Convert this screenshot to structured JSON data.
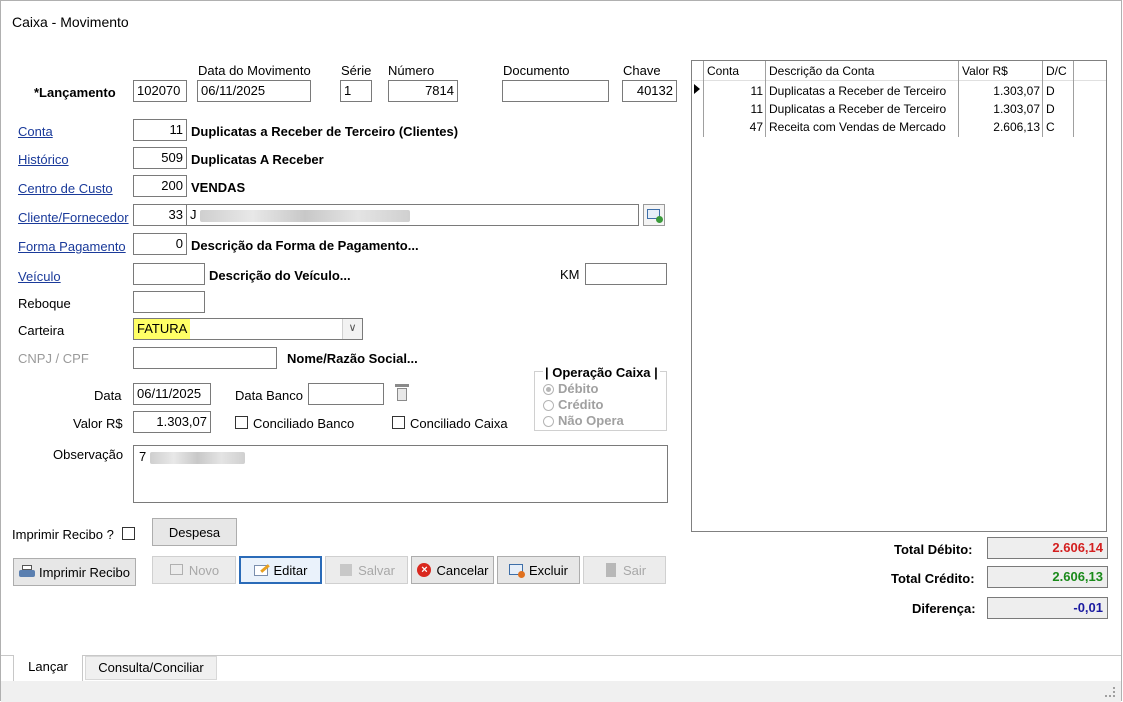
{
  "window": {
    "title": "Caixa - Movimento"
  },
  "header": {
    "lancamento_label": "*Lançamento",
    "lancamento_value": "102070",
    "data_mov_label": "Data do Movimento",
    "data_mov_value": "06/11/2025",
    "serie_label": "Série",
    "serie_value": "1",
    "numero_label": "Número",
    "numero_value": "7814",
    "documento_label": "Documento",
    "documento_value": "",
    "chave_label": "Chave",
    "chave_value": "40132"
  },
  "fields": {
    "conta_label": "Conta",
    "conta_value": "11",
    "conta_desc": "Duplicatas a Receber de Terceiro (Clientes)",
    "historico_label": "Histórico",
    "historico_value": "509",
    "historico_desc": "Duplicatas A Receber",
    "centro_label": "Centro de Custo",
    "centro_value": "200",
    "centro_desc": "VENDAS",
    "cliente_label": "Cliente/Fornecedor",
    "cliente_value": "33",
    "cliente_name_initial": "J",
    "forma_label": "Forma Pagamento",
    "forma_value": "0",
    "forma_desc": "Descrição da Forma de Pagamento...",
    "veiculo_label": "Veículo",
    "veiculo_value": "",
    "veiculo_desc": "Descrição do Veículo...",
    "km_label": "KM",
    "km_value": "",
    "reboque_label": "Reboque",
    "reboque_value": "",
    "carteira_label": "Carteira",
    "carteira_value": "FATURA",
    "cnpj_label": "CNPJ / CPF",
    "cnpj_value": "",
    "nome_label": "Nome/Razão Social...",
    "data_label": "Data",
    "data_value": "06/11/2025",
    "data_banco_label": "Data Banco",
    "data_banco_value": "",
    "valor_label": "Valor R$",
    "valor_value": "1.303,07",
    "conciliado_banco_label": "Conciliado Banco",
    "conciliado_caixa_label": "Conciliado Caixa",
    "observacao_label": "Observação",
    "observacao_initial": "7"
  },
  "operacao": {
    "title": "| Operação Caixa |",
    "options": [
      "Débito",
      "Crédito",
      "Não Opera"
    ],
    "selected": "Débito"
  },
  "recibo": {
    "label": "Imprimir Recibo ?",
    "despesa_label": "Despesa"
  },
  "toolbar": {
    "imprimir_label": "Imprimir Recibo",
    "novo_label": "Novo",
    "editar_label": "Editar",
    "salvar_label": "Salvar",
    "cancelar_label": "Cancelar",
    "excluir_label": "Excluir",
    "sair_label": "Sair"
  },
  "grid": {
    "columns": [
      "Conta",
      "Descrição da Conta",
      "Valor R$",
      "D/C"
    ],
    "rows": [
      {
        "conta": "11",
        "descricao": "Duplicatas a Receber de Terceiro",
        "valor": "1.303,07",
        "dc": "D"
      },
      {
        "conta": "11",
        "descricao": "Duplicatas a Receber de Terceiro",
        "valor": "1.303,07",
        "dc": "D"
      },
      {
        "conta": "47",
        "descricao": "Receita com Vendas de Mercado",
        "valor": "2.606,13",
        "dc": "C"
      }
    ]
  },
  "totals": {
    "debito_label": "Total Débito:",
    "debito_value": "2.606,14",
    "debito_color": "#d42020",
    "credito_label": "Total Crédito:",
    "credito_value": "2.606,13",
    "credito_color": "#1a8a1a",
    "diferenca_label": "Diferença:",
    "diferenca_value": "-0,01",
    "diferenca_color": "#1a1aa0"
  },
  "tabs": [
    {
      "label": "Lançar",
      "active": true
    },
    {
      "label": "Consulta/Conciliar",
      "active": false
    }
  ]
}
